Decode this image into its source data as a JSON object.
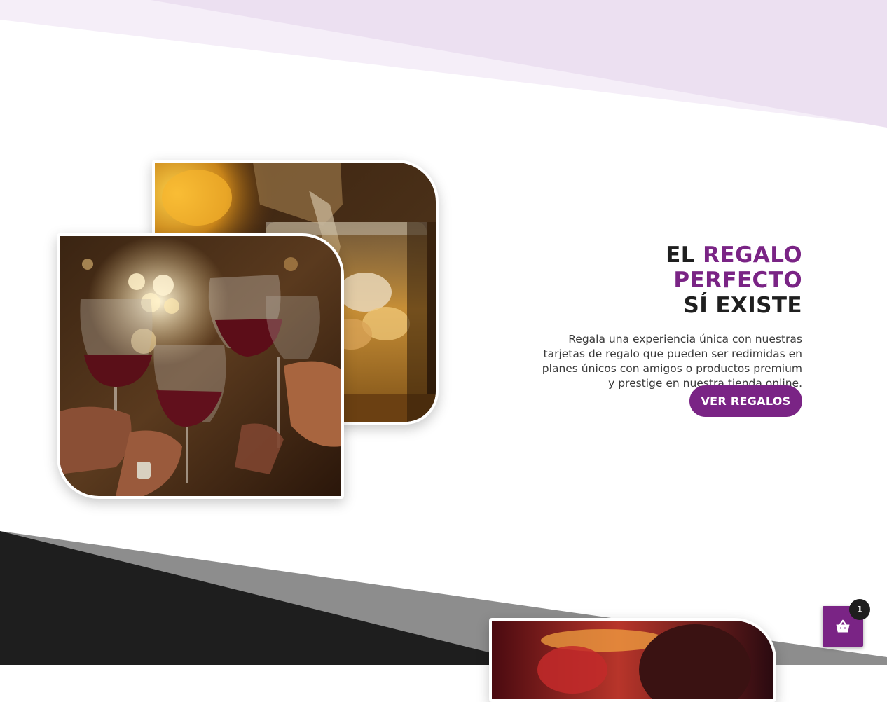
{
  "hero": {
    "headline": {
      "lead": "EL",
      "accent": "REGALO PERFECTO",
      "tail": "SÍ EXISTE"
    },
    "description": "Regala una experiencia única con nuestras tarjetas de regalo que pueden ser redimidas en planes únicos con amigos o productos premium y prestige en nuestra tienda online.",
    "cta_label": "VER REGALOS"
  },
  "cart": {
    "count": "1",
    "icon": "shopping-bag-icon"
  },
  "colors": {
    "accent": "#7a2485",
    "dark": "#1e1e1e",
    "lavender": "#ede1f2"
  }
}
